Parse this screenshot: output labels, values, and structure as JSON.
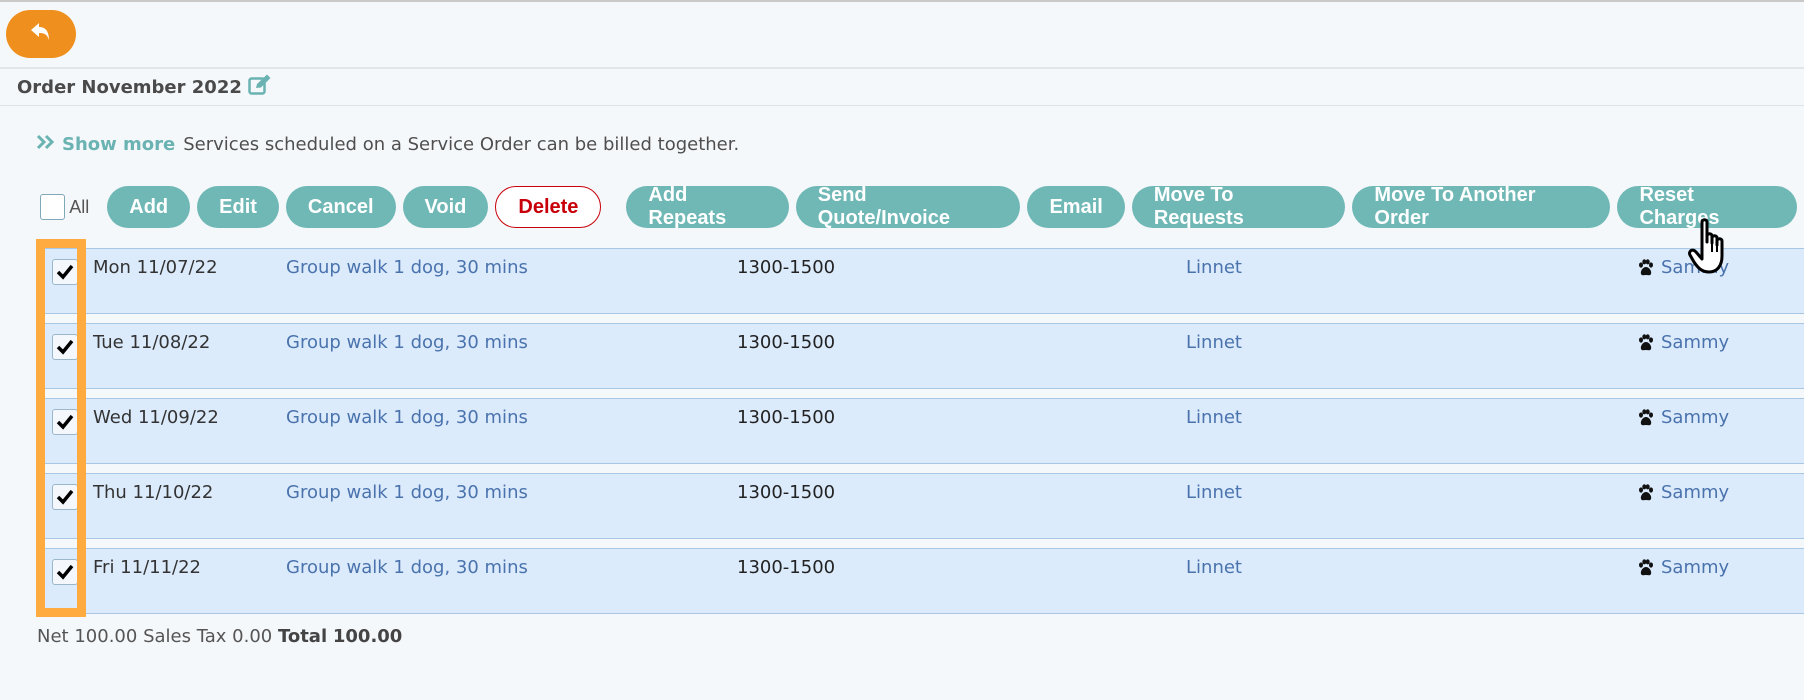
{
  "header": {
    "back_icon": "reply-arrow-icon",
    "title": "Order November 2022",
    "edit_icon": "edit-square-icon"
  },
  "info": {
    "toggle_icon": "double-chevron-right-icon",
    "show_more_label": "Show more",
    "description": "Services scheduled on a Service Order can be billed together."
  },
  "toolbar": {
    "select_all_label": "All",
    "select_all_checked": false,
    "buttons": [
      {
        "label": "Add"
      },
      {
        "label": "Edit"
      },
      {
        "label": "Cancel"
      },
      {
        "label": "Void"
      },
      {
        "label": "Delete"
      },
      {
        "label": "Add Repeats"
      },
      {
        "label": "Send Quote/Invoice"
      },
      {
        "label": "Email"
      },
      {
        "label": "Move To Requests"
      },
      {
        "label": "Move To Another Order"
      },
      {
        "label": "Reset Charges"
      }
    ]
  },
  "rows": [
    {
      "checked": true,
      "date": "Mon 11/07/22",
      "service": "Group walk 1 dog, 30 mins",
      "time": "1300-1500",
      "staff": "Linnet",
      "pet_icon": "paw-icon",
      "pet": "Sammy"
    },
    {
      "checked": true,
      "date": "Tue 11/08/22",
      "service": "Group walk 1 dog, 30 mins",
      "time": "1300-1500",
      "staff": "Linnet",
      "pet_icon": "paw-icon",
      "pet": "Sammy"
    },
    {
      "checked": true,
      "date": "Wed 11/09/22",
      "service": "Group walk 1 dog, 30 mins",
      "time": "1300-1500",
      "staff": "Linnet",
      "pet_icon": "paw-icon",
      "pet": "Sammy"
    },
    {
      "checked": true,
      "date": "Thu 11/10/22",
      "service": "Group walk 1 dog, 30 mins",
      "time": "1300-1500",
      "staff": "Linnet",
      "pet_icon": "paw-icon",
      "pet": "Sammy"
    },
    {
      "checked": true,
      "date": "Fri 11/11/22",
      "service": "Group walk 1 dog, 30 mins",
      "time": "1300-1500",
      "staff": "Linnet",
      "pet_icon": "paw-icon",
      "pet": "Sammy"
    }
  ],
  "totals": {
    "net_label": "Net",
    "net": "100.00",
    "tax_label": "Sales Tax",
    "tax": "0.00",
    "total_label": "Total",
    "total": "100.00"
  },
  "colors": {
    "accent_orange": "#ef8f1d",
    "button_teal": "#6fb8b6",
    "delete_red": "#c8000a",
    "row_bg": "#dcebfc",
    "link_blue": "#4a73ad",
    "highlight": "#ffab40"
  }
}
